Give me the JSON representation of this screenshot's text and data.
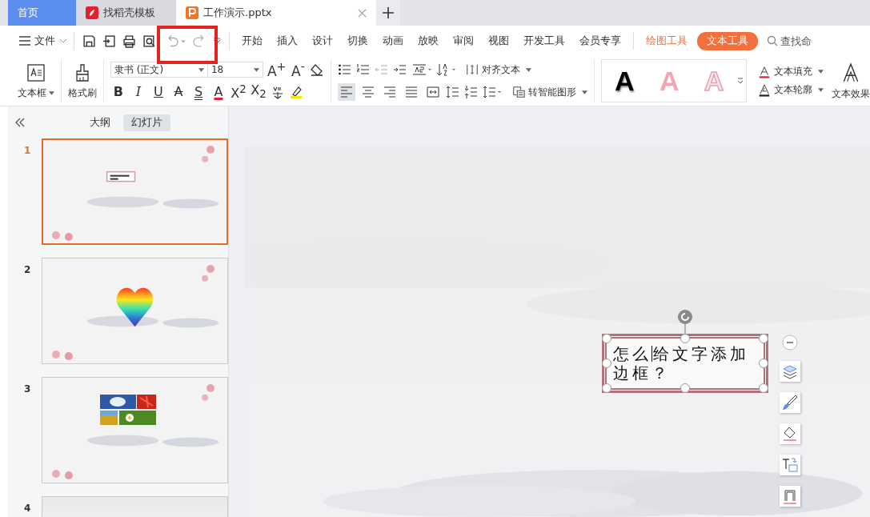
{
  "tabs": [
    {
      "label": "首页",
      "kind": "home",
      "selected": false
    },
    {
      "label": "找稻壳模板",
      "kind": "template",
      "selected": false
    },
    {
      "label": "工作演示.pptx",
      "kind": "document",
      "selected": true
    }
  ],
  "file_menu": {
    "label": "文件"
  },
  "ribbon_tabs": [
    {
      "label": "开始",
      "kind": "normal",
      "selected": false
    },
    {
      "label": "插入",
      "kind": "normal",
      "selected": false
    },
    {
      "label": "设计",
      "kind": "normal",
      "selected": false
    },
    {
      "label": "切换",
      "kind": "normal",
      "selected": false
    },
    {
      "label": "动画",
      "kind": "normal",
      "selected": false
    },
    {
      "label": "放映",
      "kind": "normal",
      "selected": false
    },
    {
      "label": "审阅",
      "kind": "normal",
      "selected": false
    },
    {
      "label": "视图",
      "kind": "normal",
      "selected": false
    },
    {
      "label": "开发工具",
      "kind": "normal",
      "selected": false
    },
    {
      "label": "会员专享",
      "kind": "normal",
      "selected": false
    },
    {
      "label": "绘图工具",
      "kind": "contextual",
      "selected": false
    },
    {
      "label": "文本工具",
      "kind": "contextual",
      "selected": true
    }
  ],
  "search": {
    "placeholder": "查找命"
  },
  "ribbon": {
    "text_box": "文本框",
    "format_painter": "格式刷",
    "font": {
      "value": "隶书 (正文)"
    },
    "font_size": {
      "value": "18"
    },
    "size_buttons": [
      {
        "label": "A$^{+}$"
      },
      {
        "label": "A$^{-}$"
      }
    ],
    "format_buttons": [
      {
        "label": "B",
        "kind": "bold"
      },
      {
        "label": "I",
        "kind": "italic"
      },
      {
        "label": "U",
        "kind": "underline"
      },
      {
        "label": "A",
        "kind": "strike"
      },
      {
        "label": "S",
        "kind": "double"
      },
      {
        "label": "A",
        "kind": "color"
      },
      {
        "label": "X$^{2}$",
        "kind": "plain"
      },
      {
        "label": "X$_{2}$",
        "kind": "plain"
      }
    ],
    "align_buttons": [
      {
        "kind": "left",
        "selected": true
      },
      {
        "kind": "center",
        "selected": false
      },
      {
        "kind": "right",
        "selected": false
      },
      {
        "kind": "justify",
        "selected": false
      },
      {
        "kind": "distributed",
        "selected": false
      }
    ],
    "align_text": "对齐文本",
    "smart_shape": "转智能图形",
    "art_styles": [
      {
        "label": "A",
        "kind": "black"
      },
      {
        "label": "A",
        "kind": "pink"
      },
      {
        "label": "A",
        "kind": "outline"
      }
    ],
    "text_fill": "文本填充",
    "text_outline": "文本轮廓",
    "text_effect": "文本效果"
  },
  "panel": {
    "tabs": [
      {
        "label": "大纲",
        "selected": false
      },
      {
        "label": "幻灯片",
        "selected": true
      }
    ],
    "slides": [
      {
        "number": "1",
        "kind": "text",
        "selected": true
      },
      {
        "number": "2",
        "kind": "heart",
        "selected": false
      },
      {
        "number": "3",
        "kind": "photos",
        "selected": false
      },
      {
        "number": "4",
        "kind": "plain",
        "selected": false
      }
    ]
  },
  "slide": {
    "text_box": {
      "before_caret": "怎么",
      "after_caret": "给文字添加边框？"
    }
  }
}
